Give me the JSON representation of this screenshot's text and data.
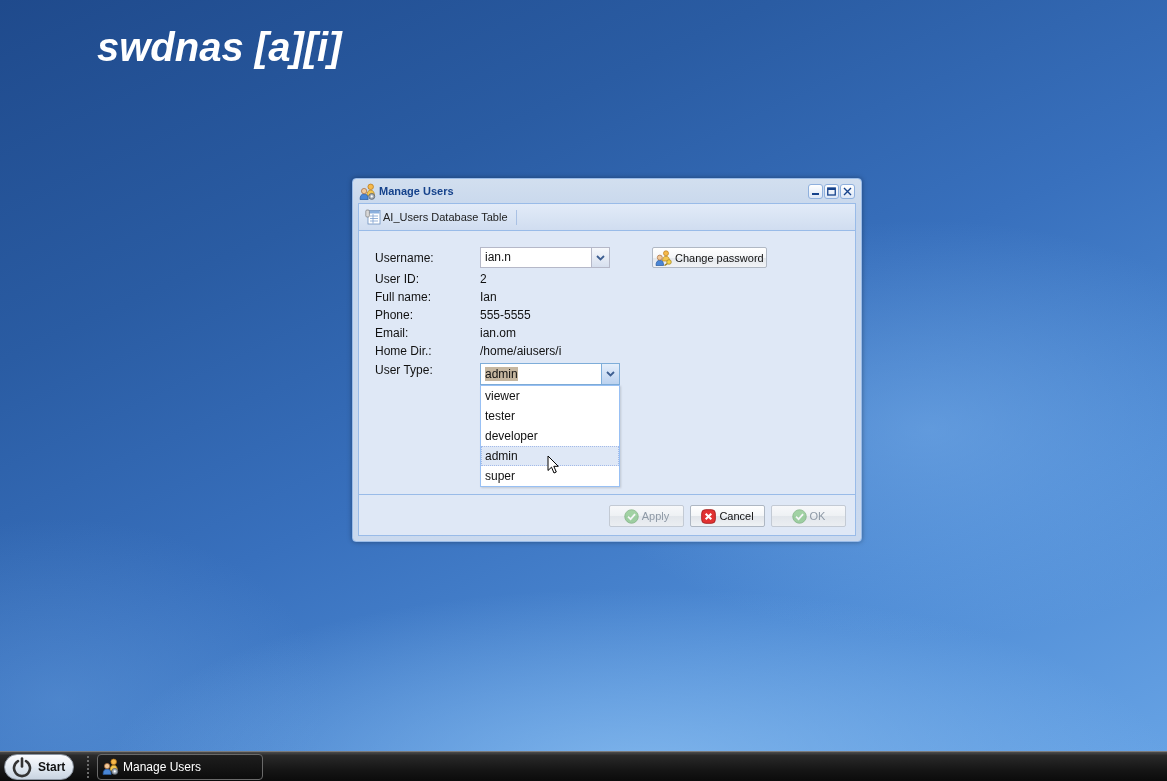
{
  "desktop": {
    "title": "swdnas [a][i]"
  },
  "window": {
    "title": "Manage Users",
    "toolbar_label": "AI_Users Database Table",
    "form": {
      "username": {
        "label": "Username:",
        "value": "ian.n"
      },
      "change_password": "Change password",
      "details": [
        {
          "label": "User ID:",
          "value": "2"
        },
        {
          "label": "Full name:",
          "value": "Ian"
        },
        {
          "label": "Phone:",
          "value": "555-5555"
        },
        {
          "label": "Email:",
          "value": "ian.om"
        },
        {
          "label": "Home Dir.:",
          "value": "/home/aiusers/i"
        }
      ],
      "user_type": {
        "label": "User Type:",
        "value": "admin",
        "focused": true,
        "expanded": true,
        "options": [
          {
            "label": "viewer",
            "selected": false
          },
          {
            "label": "tester",
            "selected": false
          },
          {
            "label": "developer",
            "selected": false
          },
          {
            "label": "admin",
            "selected": true
          },
          {
            "label": "super",
            "selected": false
          }
        ]
      }
    },
    "buttons": [
      {
        "label": "Apply",
        "kind": "confirm",
        "disabled": true
      },
      {
        "label": "Cancel",
        "kind": "cancel",
        "disabled": false
      },
      {
        "label": "OK",
        "kind": "confirm",
        "disabled": true
      }
    ]
  },
  "taskbar": {
    "start": "Start",
    "tasks": [
      {
        "label": "Manage Users",
        "selected": true
      }
    ]
  }
}
